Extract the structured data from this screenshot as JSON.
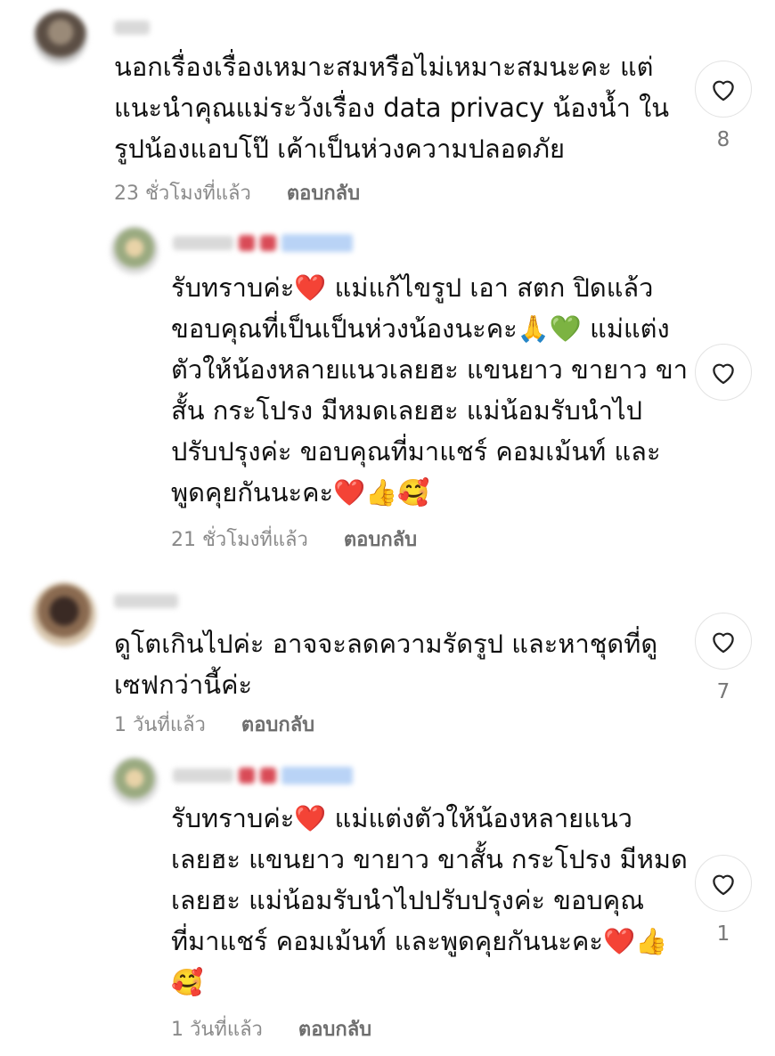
{
  "comments": [
    {
      "username": "ษะษุ",
      "text": "นอกเรื่องเรื่องเหมาะสมหรือไม่เหมาะสมนะคะ แต่\nแนะนำคุณแม่ระวังเรื่อง data privacy น้องน้ำ ใน\nรูปน้องแอบโป๊ เค้าเป็นห่วงความปลอดภัย",
      "time": "23 ชั่วโมงที่แล้ว",
      "reply_label": "ตอบกลับ",
      "likes": "8",
      "avatar_color": "#8a7a6a"
    },
    {
      "username": "ผู้เขียน",
      "text": "รับทราบค่ะ❤️ แม่แก้ไขรูป เอา สตก ปิดแล้ว\nขอบคุณที่เป็นเป็นห่วงน้องนะคะ🙏💚 แม่แต่ง\nตัวให้น้องหลายแนวเลยฮะ แขนยาว ขายาว ขา\nสั้น กระโปรง มีหมดเลยฮะ แม่น้อมรับนำไป\nปรับปรุงค่ะ ขอบคุณที่มาแชร์ คอมเม้นท์ และ\nพูดคุยกันนะคะ❤️👍🥰",
      "time": "21 ชั่วโมงที่แล้ว",
      "reply_label": "ตอบกลับ",
      "likes": "",
      "avatar_color": "#b8c4a0"
    },
    {
      "username": "ผู้ใช้",
      "text": "ดูโตเกินไปค่ะ อาจจะลดความรัดรูป และหาชุดที่ดู\nเซฟกว่านี้ค่ะ",
      "time": "1 วันที่แล้ว",
      "reply_label": "ตอบกลับ",
      "likes": "7",
      "avatar_color": "#6a5040"
    },
    {
      "username": "ผู้เขียน",
      "text": "รับทราบค่ะ❤️ แม่แต่งตัวให้น้องหลายแนว\nเลยฮะ แขนยาว ขายาว ขาสั้น กระโปรง มีหมด\nเลยฮะ แม่น้อมรับนำไปปรับปรุงค่ะ ขอบคุณ\nที่มาแชร์ คอมเม้นท์ และพูดคุยกันนะคะ❤️👍\n🥰",
      "time": "1 วันที่แล้ว",
      "reply_label": "ตอบกลับ",
      "likes": "1",
      "avatar_color": "#b8c4a0"
    }
  ]
}
